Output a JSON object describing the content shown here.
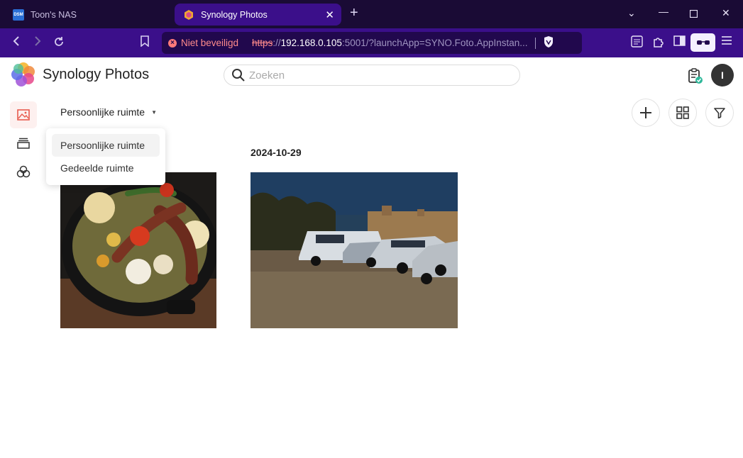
{
  "browser": {
    "tabs": [
      {
        "title": "Toon's NAS",
        "favicon_text": "DSM",
        "active": false
      },
      {
        "title": "Synology Photos",
        "active": true
      }
    ],
    "address": {
      "security_warning": "Niet beveiligd",
      "scheme": "https",
      "host": "192.168.0.105",
      "rest": ":5001/?launchApp=SYNO.Foto.AppInstan..."
    },
    "colors": {
      "titlebar": "#1a0b35",
      "toolbar": "#3b0f8a",
      "warning": "#ff8b8b"
    }
  },
  "app": {
    "title": "Synology Photos",
    "search_placeholder": "Zoeken",
    "avatar_initial": "I",
    "accent": "#e85b4e",
    "sidebar": [
      {
        "icon": "photo-icon",
        "active": true
      },
      {
        "icon": "albums-icon",
        "active": false
      },
      {
        "icon": "shared-icon",
        "active": false
      }
    ],
    "space_selector": {
      "current": "Persoonlijke ruimte",
      "options": [
        "Persoonlijke ruimte",
        "Gedeelde ruimte"
      ]
    },
    "toolbar": [
      "add-icon",
      "grid-view-icon",
      "filter-icon"
    ],
    "timeline": {
      "date": "2024-10-29",
      "photos": [
        {
          "subject": "grilled food in pan"
        },
        {
          "subject": "cars parked at night"
        }
      ]
    }
  }
}
